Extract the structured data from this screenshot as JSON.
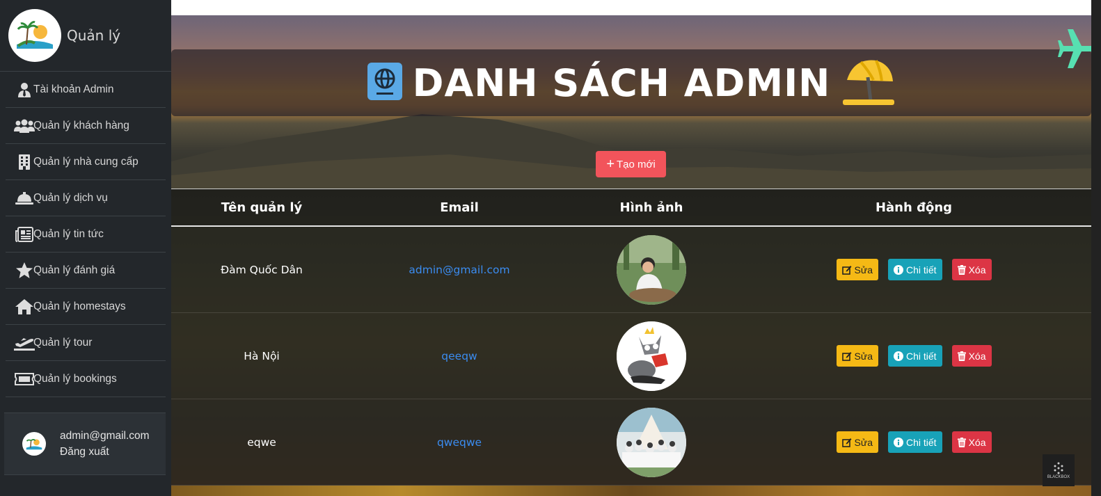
{
  "sidebar": {
    "brand_title": "Quản lý",
    "items": [
      {
        "label": "Tài khoản Admin",
        "icon": "user-tie-icon"
      },
      {
        "label": "Quản lý khách hàng",
        "icon": "users-icon"
      },
      {
        "label": "Quản lý nhà cung cấp",
        "icon": "building-icon"
      },
      {
        "label": "Quản lý dịch vụ",
        "icon": "concierge-bell-icon"
      },
      {
        "label": "Quản lý tin tức",
        "icon": "newspaper-icon"
      },
      {
        "label": "Quản lý đánh giá",
        "icon": "star-icon"
      },
      {
        "label": "Quản lý homestays",
        "icon": "home-icon"
      },
      {
        "label": "Quản lý tour",
        "icon": "plane-departure-icon"
      },
      {
        "label": "Quản lý bookings",
        "icon": "ticket-icon"
      }
    ],
    "user": {
      "email": "admin@gmail.com",
      "logout": "Đăng xuất"
    }
  },
  "main": {
    "title": "DANH SÁCH ADMIN",
    "create_label": "Tạo mới",
    "table": {
      "headers": [
        "Tên quản lý",
        "Email",
        "Hình ảnh",
        "Hành động"
      ],
      "rows": [
        {
          "name": "Đàm Quốc Dân",
          "email": "admin@gmail.com"
        },
        {
          "name": "Hà Nội",
          "email": "qeeqw"
        },
        {
          "name": "eqwe",
          "email": "qweqwe"
        }
      ],
      "actions": {
        "edit": "Sửa",
        "detail": "Chi tiết",
        "delete": "Xóa"
      }
    }
  },
  "watermark": "BLACKBOX",
  "colors": {
    "sidebar_bg": "#23272b",
    "create_button": "#f2545b",
    "edit_button": "#f5b915",
    "detail_button": "#18a2b8",
    "delete_button": "#dc3545",
    "email_link": "#3b8cf0"
  }
}
